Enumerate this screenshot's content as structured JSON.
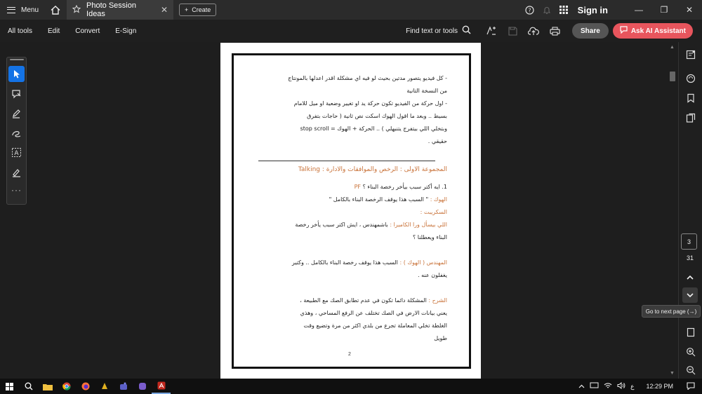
{
  "titlebar": {
    "menu_label": "Menu",
    "tab_title": "Photo Session Ideas",
    "tab_close": "✕",
    "create_label": "Create",
    "signin_label": "Sign in",
    "minimize": "—",
    "maximize": "❐",
    "close": "✕"
  },
  "toolbar": {
    "all_tools": "All tools",
    "edit": "Edit",
    "convert": "Convert",
    "esign": "E-Sign",
    "find_label": "Find text or tools",
    "share_label": "Share",
    "ai_label": "Ask AI Assistant"
  },
  "palette": {
    "more": "···"
  },
  "document": {
    "bullets": [
      "-   كل فيديو يتصور مدتين بحيث لو فيه اي مشكلة اقدر اعدلها بالمونتاج",
      "من النسخة التانية",
      "-   اول حركة من الفيديو تكون حركة يد او تغيير وضعية او ميل للامام",
      "بسيط .. وبعد ما اقول الهوك اسكت نص ثانية ( حاجات بتفرق",
      "وبتخلي اللي بيتفرج يتنبهلي ) .. الحركة + الهوك =  stop scroll",
      "حقيقي ."
    ],
    "heading": "المجموعة الاولى : الرخص والموافقات والادارة : Talking",
    "q1_prefix": "1.  ايه أكتر سبب بيأخر رخصة البناء ؟",
    "q1_tag": "PF",
    "hook_label": "الهوك :",
    "hook_text": "\" السبب هذا يوقف الرخصة البناء بالكامل \"",
    "script_label": "السكريبت :",
    "asker_label": "اللي بيسأل ورا الكاميرا :",
    "asker_text": "باشمهندس ، ايش اكتر سبب يأخر رخصة",
    "asker_text2": "البناء ويعطلنا ؟",
    "engineer_label": "المهندس ( الهوك ) :",
    "engineer_text": "السبب هذا يوقف رخصة البناء بالكامل .. وكتير",
    "engineer_text2": "يغفلون عنه .",
    "explain_label": "الشرح :",
    "explain_text": "المشكلة دائما تكون في عدم تطابق الصك مع الطبيعة ،",
    "explain_text2": "يعني بيانات الارض في الصك تختلف عن الرفع المساحي ، وهذي",
    "explain_text3": "الغلطة تخلي المعاملة تجرع من بلدي اكثر من مرة وتضيع وقت",
    "explain_text4": "طويل",
    "page_number": "2"
  },
  "navigation": {
    "current_page": "3",
    "total_pages": "31",
    "tooltip": "Go to next page (→)"
  },
  "taskbar": {
    "lang": "ع",
    "time": "12:29 PM"
  },
  "colors": {
    "accent": "#1473e6",
    "ai_button": "#e8555d",
    "doc_orange": "#c9733a"
  }
}
